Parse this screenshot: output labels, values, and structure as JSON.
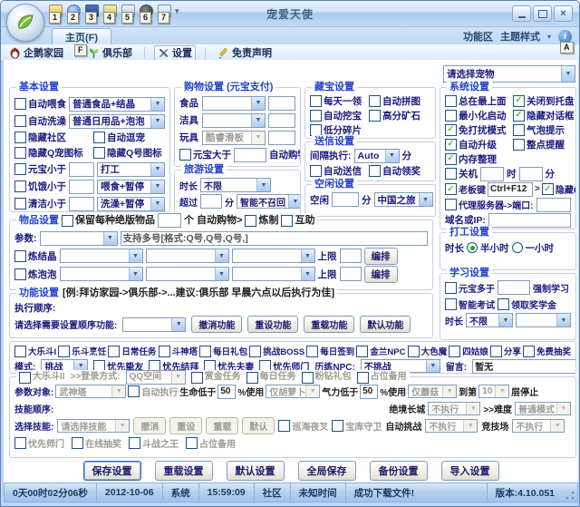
{
  "window": {
    "title": "宠爱天使",
    "qat_keytips": [
      "1",
      "2",
      "3",
      "4",
      "5",
      "6",
      "7"
    ],
    "tab": "主页(F)",
    "tab_keytip": "F",
    "ribbon_label": "功能区",
    "theme_label": "主题样式",
    "help_keytip": "A",
    "icons": [
      "app-orb-icon",
      "qat-icons-1-7",
      "minimize-icon",
      "maximize-icon",
      "close-icon",
      "help-icon",
      "chevron-down-icon"
    ]
  },
  "toolbar": {
    "items": [
      "企鹅家园",
      "俱乐部",
      "设置",
      "免责声明"
    ],
    "icons": [
      "penguin-icon",
      "club-icon",
      "tools-icon",
      "pen-icon"
    ]
  },
  "main": {
    "pet_select": "请选择宠物",
    "basic": {
      "title": "基本设置",
      "feed_label": "自动喂食",
      "feed_value": "普通食品+结晶",
      "bath_label": "自动洗澡",
      "bath_value": "普通日用品+泡泡",
      "hide_community": "隐藏社区",
      "auto_tease": "自动逗宠",
      "hide_qpet": "隐藏Q宠图标",
      "hide_qnum": "隐藏Q号图标",
      "yb_label": "元宝小于",
      "yb_action": "打工",
      "hunger_label": "饥饿小于",
      "hunger_action": "喂食+暂停",
      "clean_label": "清洁小于",
      "clean_action": "洗澡+暂停"
    },
    "shopping": {
      "title": "购物设置 (元宝支付)",
      "food_label": "食品",
      "clean_label": "洁具",
      "toy_label": "玩具",
      "toy_value": "酷睿滑板",
      "gt_label": "元宝大于",
      "auto_label": "自动购物"
    },
    "travel": {
      "title": "旅游设置",
      "dur_label": "时长",
      "dur_value": "不限",
      "over_label": "超过",
      "minute": "分",
      "recall_value": "智能不召回"
    },
    "treasure": {
      "title": "藏宝设置",
      "c1": "每天一领",
      "c2": "自动拼图",
      "c3": "自动挖宝",
      "c4": "高分矿石",
      "c5": "低分碎片"
    },
    "letter": {
      "title": "送信设置",
      "int_label": "间隔执行:",
      "int_value": "Auto",
      "minute": "分",
      "c1": "自动送信",
      "c2": "自动领奖"
    },
    "idle": {
      "title": "空闲设置",
      "label": "空闲",
      "minute": "分",
      "value": "中国之旅"
    },
    "system": {
      "title": "系统设置",
      "checks": [
        {
          "label": "总在最上面",
          "checked": false
        },
        {
          "label": "关闭到托盘",
          "checked": true
        },
        {
          "label": "最小化启动",
          "checked": false
        },
        {
          "label": "隐藏对话框",
          "checked": true
        },
        {
          "label": "免打扰模式",
          "checked": true
        },
        {
          "label": "气泡提示",
          "checked": false
        },
        {
          "label": "自动升级",
          "checked": true
        },
        {
          "label": "整点提醒",
          "checked": false
        },
        {
          "label": "内存整理",
          "checked": true
        }
      ],
      "shutdown_label": "关机",
      "hour": "时",
      "minute": "分",
      "bosskey_label": "老板键",
      "bosskey_value": "Ctrl+F12",
      "bosskey_sep": ">",
      "hideqq_label": "隐藏QQ",
      "proxy_label": "代理服务器->端口:",
      "domain_label": "域名或IP:"
    },
    "work": {
      "title": "打工设置",
      "dur_label": "时长",
      "r1": "半小时",
      "r1_checked": true,
      "r2": "一小时",
      "r2_checked": false
    },
    "study": {
      "title": "学习设置",
      "yb_label": "元宝多于",
      "force_label": "强制学习",
      "exam_label": "智能考试",
      "scholarship_label": "领取奖学金",
      "dur_label": "时长",
      "dur_value": "不限"
    },
    "items": {
      "title": "物品设置",
      "keep_label": "保留每种绝版物品",
      "keep_suffix": "个 自动购物>",
      "refine_label": "炼制",
      "mutual_label": "互助",
      "param_label": "参数:",
      "param_hint": "支持多号[格式:Q号,Q号,Q号,]",
      "crystal_label": "炼结晶",
      "bubble_label": "炼泡泡",
      "limit_label": "上限",
      "arrange_label": "编排"
    },
    "func": {
      "title": "功能设置",
      "hint": "[例:拜访家园->俱乐部->...建议:俱乐部 早晨六点以后执行为佳]",
      "order_label": "执行顺序:",
      "select_label": "请选择需要设置顺序功能:",
      "buttons": [
        "撤消功能",
        "重设功能",
        "重载功能",
        "默认功能"
      ]
    },
    "dou1": {
      "checks": [
        "大乐斗I",
        "乐斗烹饪",
        "日常任务",
        "斗神塔",
        "每日礼包",
        "挑战BOSS",
        "每日签到",
        "金兰NPC",
        "大色魔",
        "四姑娘",
        "分享",
        "免费抽奖"
      ],
      "mode_label": "模式:",
      "mode_value": "挑战",
      "prefs": [
        "忧先挚友",
        "忧先结拜",
        "忧先夫妻",
        "忧先师门"
      ],
      "lilian_label": "历练NPC:",
      "lilian_value": "不挑战",
      "msg_label": "留言:",
      "msg_value": "暂无"
    },
    "dou2": {
      "title": "大乐斗II",
      "login_label": ">>登录方式:",
      "login_value": "QQ空间",
      "title_checks": [
        "赏金任务",
        "每日任务",
        "粉钻礼包",
        "占位备用"
      ],
      "param_label": "参数对象:",
      "param_value": "武神塔",
      "auto_exec": "自动执行",
      "hp_label": "生命低于",
      "hp_value": "50",
      "hp_use": "%使用",
      "hp_item": "仅胡萝卜",
      "mp_label": "气力低于",
      "mp_value": "50",
      "mp_use": "%使用",
      "mp_item": "仅蘑菇",
      "floor_label": "到第",
      "floor_value": "10",
      "floor_suffix": "层停止",
      "skill_order_label": "技能顺序:",
      "wall_label": "绝境长城",
      "wall_value": "不执行",
      "difficulty_label": ">>难度",
      "difficulty_value": "普通模式",
      "skill_label": "选择技能:",
      "skill_value": "请选择技能",
      "skill_buttons": [
        "撤消",
        "重设",
        "重载",
        "默认"
      ],
      "xunhai_label": "巡海夜叉",
      "baoku_label": "宝库守卫",
      "auto_ch_label": "自动挑战",
      "auto_ch_value": "不执行",
      "arena_label": "竞技场",
      "arena_value": "不执行",
      "bottom_checks": [
        "忧先师门",
        "在线抽奖",
        "斗战之王",
        "占位备用"
      ]
    },
    "footer_buttons": [
      "保存设置",
      "重载设置",
      "默认设置",
      "全局保存",
      "备份设置",
      "导入设置"
    ]
  },
  "statusbar": {
    "segments": [
      "0天00时02分06秒",
      "2012-10-06",
      "系统",
      "15:59:09",
      "社区",
      "未知时间",
      "成功下载文件!"
    ],
    "version": "版本:4.10.051"
  },
  "colors": {
    "accent": "#2443cf",
    "check_green": "#1fa31f",
    "titlebar_blue": "#bdd7f4"
  }
}
